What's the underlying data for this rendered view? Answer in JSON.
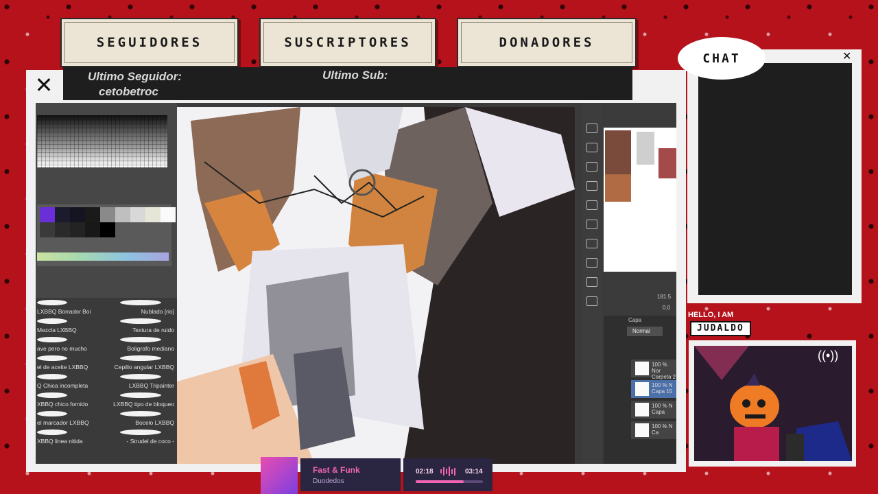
{
  "overlay": {
    "tags": [
      "SEGUIDORES",
      "SUSCRIPTORES",
      "DONADORES"
    ],
    "last_follower_label": "Ultimo Seguidor:",
    "last_follower_name": "cetobetroc",
    "last_sub_label": "Ultimo Sub:"
  },
  "chat": {
    "title": "CHAT"
  },
  "streamer": {
    "hello": "HELLO, I AM",
    "name": "JUDALDO"
  },
  "music": {
    "title": "Fast & Funk",
    "artist": "Duodedos",
    "current_time": "02:18",
    "total_time": "03:14",
    "progress": 0.71
  },
  "app": {
    "palette_colors": [
      "#6a2fd6",
      "#1b1b2e",
      "#151522",
      "#1a1a1a",
      "#8a8a8a",
      "#bfbfbf",
      "#d8d8d8",
      "#e6e6d8",
      "#fafafa",
      "#3a3a3a",
      "#2a2a2a",
      "#232323",
      "#181818",
      "#000000"
    ],
    "brushes": [
      {
        "left": "LXBBQ Borrador Boi",
        "right": "Nublado [rio]"
      },
      {
        "left": "Mezcla LXBBQ",
        "right": "Textura de ruido"
      },
      {
        "left": "ave pero no mucho",
        "right": "Boligrafo mediano"
      },
      {
        "left": "el de aceite LXBBQ",
        "right": "Cepillo angular LXBBQ"
      },
      {
        "left": "Q Chica incompleta",
        "right": "LXBBQ Tripainter"
      },
      {
        "left": "XBBQ chico fornido",
        "right": "LXBBQ tipo de bloqueo"
      },
      {
        "left": "el marcador LXBBQ",
        "right": "Bocelo LXBBQ"
      },
      {
        "left": "XBBQ linea nitida",
        "right": "- Strudel de coco -"
      }
    ],
    "layer_title": "Capa",
    "blend_mode": "Normal",
    "zoom": "181.5",
    "rotation": "0.0",
    "layers": [
      {
        "line1": "100 % Nor",
        "line2": "Carpeta 2"
      },
      {
        "line1": "100 % N",
        "line2": "Capa 15"
      },
      {
        "line1": "100 % N",
        "line2": "Capa"
      },
      {
        "line1": "100 % N",
        "line2": "Ca"
      }
    ]
  }
}
